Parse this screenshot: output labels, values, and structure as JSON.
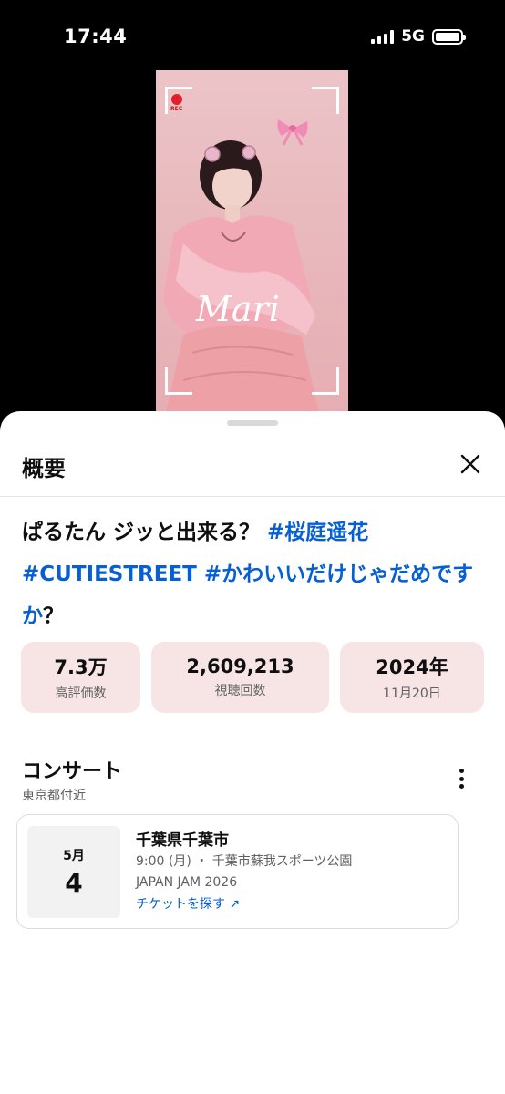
{
  "status_bar": {
    "time": "17:44",
    "network": "5G"
  },
  "video": {
    "rec_label": "REC",
    "logo_text": "Mari"
  },
  "sheet": {
    "title": "概要",
    "description_parts": [
      {
        "text": "ぱるたん ジッと出来る？ ",
        "tag": false
      },
      {
        "text": "#桜庭遥花",
        "tag": true
      },
      {
        "text": " #CUTIESTREET",
        "tag": true
      },
      {
        "text": " #かわいいだけじゃだめですか",
        "tag": true
      },
      {
        "text": "？",
        "tag": false
      }
    ],
    "stats": [
      {
        "value": "7.3万",
        "label": "高評価数"
      },
      {
        "value": "2,609,213",
        "label": "視聴回数"
      },
      {
        "value": "2024年",
        "label": "11月20日"
      }
    ],
    "concert": {
      "title": "コンサート",
      "subtitle": "東京都付近",
      "event": {
        "month": "5月",
        "day": "4",
        "city": "千葉県千葉市",
        "time_venue": "9:00 (月) ・ 千葉市蘇我スポーツ公園",
        "name": "JAPAN JAM 2026",
        "ticket_label": "チケットを探す ↗"
      }
    }
  },
  "colors": {
    "accent_link": "#065fd4",
    "stat_bg": "#f7e4e5"
  },
  "icons": [
    "signal-icon",
    "battery-icon",
    "rec-dot-icon",
    "ribbon-icon",
    "close-icon",
    "more-vert-icon",
    "external-link-icon"
  ]
}
